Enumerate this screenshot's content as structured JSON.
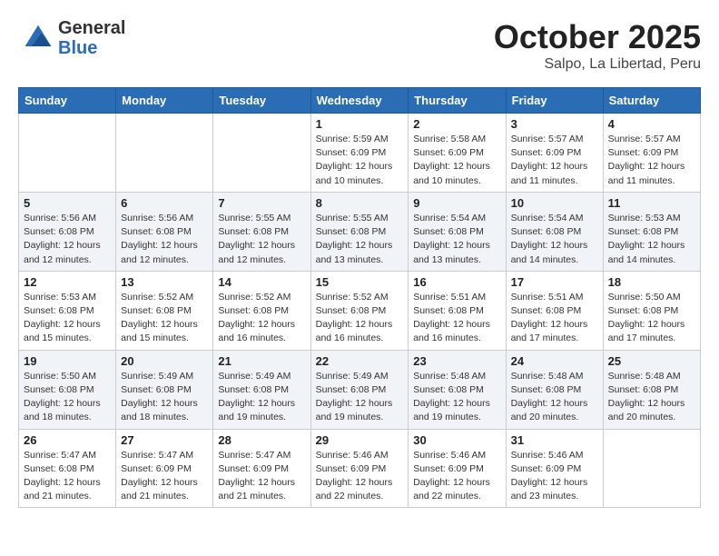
{
  "header": {
    "logo_general": "General",
    "logo_blue": "Blue",
    "month": "October 2025",
    "location": "Salpo, La Libertad, Peru"
  },
  "days_of_week": [
    "Sunday",
    "Monday",
    "Tuesday",
    "Wednesday",
    "Thursday",
    "Friday",
    "Saturday"
  ],
  "weeks": [
    [
      {
        "day": "",
        "info": ""
      },
      {
        "day": "",
        "info": ""
      },
      {
        "day": "",
        "info": ""
      },
      {
        "day": "1",
        "info": "Sunrise: 5:59 AM\nSunset: 6:09 PM\nDaylight: 12 hours\nand 10 minutes."
      },
      {
        "day": "2",
        "info": "Sunrise: 5:58 AM\nSunset: 6:09 PM\nDaylight: 12 hours\nand 10 minutes."
      },
      {
        "day": "3",
        "info": "Sunrise: 5:57 AM\nSunset: 6:09 PM\nDaylight: 12 hours\nand 11 minutes."
      },
      {
        "day": "4",
        "info": "Sunrise: 5:57 AM\nSunset: 6:09 PM\nDaylight: 12 hours\nand 11 minutes."
      }
    ],
    [
      {
        "day": "5",
        "info": "Sunrise: 5:56 AM\nSunset: 6:08 PM\nDaylight: 12 hours\nand 12 minutes."
      },
      {
        "day": "6",
        "info": "Sunrise: 5:56 AM\nSunset: 6:08 PM\nDaylight: 12 hours\nand 12 minutes."
      },
      {
        "day": "7",
        "info": "Sunrise: 5:55 AM\nSunset: 6:08 PM\nDaylight: 12 hours\nand 12 minutes."
      },
      {
        "day": "8",
        "info": "Sunrise: 5:55 AM\nSunset: 6:08 PM\nDaylight: 12 hours\nand 13 minutes."
      },
      {
        "day": "9",
        "info": "Sunrise: 5:54 AM\nSunset: 6:08 PM\nDaylight: 12 hours\nand 13 minutes."
      },
      {
        "day": "10",
        "info": "Sunrise: 5:54 AM\nSunset: 6:08 PM\nDaylight: 12 hours\nand 14 minutes."
      },
      {
        "day": "11",
        "info": "Sunrise: 5:53 AM\nSunset: 6:08 PM\nDaylight: 12 hours\nand 14 minutes."
      }
    ],
    [
      {
        "day": "12",
        "info": "Sunrise: 5:53 AM\nSunset: 6:08 PM\nDaylight: 12 hours\nand 15 minutes."
      },
      {
        "day": "13",
        "info": "Sunrise: 5:52 AM\nSunset: 6:08 PM\nDaylight: 12 hours\nand 15 minutes."
      },
      {
        "day": "14",
        "info": "Sunrise: 5:52 AM\nSunset: 6:08 PM\nDaylight: 12 hours\nand 16 minutes."
      },
      {
        "day": "15",
        "info": "Sunrise: 5:52 AM\nSunset: 6:08 PM\nDaylight: 12 hours\nand 16 minutes."
      },
      {
        "day": "16",
        "info": "Sunrise: 5:51 AM\nSunset: 6:08 PM\nDaylight: 12 hours\nand 16 minutes."
      },
      {
        "day": "17",
        "info": "Sunrise: 5:51 AM\nSunset: 6:08 PM\nDaylight: 12 hours\nand 17 minutes."
      },
      {
        "day": "18",
        "info": "Sunrise: 5:50 AM\nSunset: 6:08 PM\nDaylight: 12 hours\nand 17 minutes."
      }
    ],
    [
      {
        "day": "19",
        "info": "Sunrise: 5:50 AM\nSunset: 6:08 PM\nDaylight: 12 hours\nand 18 minutes."
      },
      {
        "day": "20",
        "info": "Sunrise: 5:49 AM\nSunset: 6:08 PM\nDaylight: 12 hours\nand 18 minutes."
      },
      {
        "day": "21",
        "info": "Sunrise: 5:49 AM\nSunset: 6:08 PM\nDaylight: 12 hours\nand 19 minutes."
      },
      {
        "day": "22",
        "info": "Sunrise: 5:49 AM\nSunset: 6:08 PM\nDaylight: 12 hours\nand 19 minutes."
      },
      {
        "day": "23",
        "info": "Sunrise: 5:48 AM\nSunset: 6:08 PM\nDaylight: 12 hours\nand 19 minutes."
      },
      {
        "day": "24",
        "info": "Sunrise: 5:48 AM\nSunset: 6:08 PM\nDaylight: 12 hours\nand 20 minutes."
      },
      {
        "day": "25",
        "info": "Sunrise: 5:48 AM\nSunset: 6:08 PM\nDaylight: 12 hours\nand 20 minutes."
      }
    ],
    [
      {
        "day": "26",
        "info": "Sunrise: 5:47 AM\nSunset: 6:08 PM\nDaylight: 12 hours\nand 21 minutes."
      },
      {
        "day": "27",
        "info": "Sunrise: 5:47 AM\nSunset: 6:09 PM\nDaylight: 12 hours\nand 21 minutes."
      },
      {
        "day": "28",
        "info": "Sunrise: 5:47 AM\nSunset: 6:09 PM\nDaylight: 12 hours\nand 21 minutes."
      },
      {
        "day": "29",
        "info": "Sunrise: 5:46 AM\nSunset: 6:09 PM\nDaylight: 12 hours\nand 22 minutes."
      },
      {
        "day": "30",
        "info": "Sunrise: 5:46 AM\nSunset: 6:09 PM\nDaylight: 12 hours\nand 22 minutes."
      },
      {
        "day": "31",
        "info": "Sunrise: 5:46 AM\nSunset: 6:09 PM\nDaylight: 12 hours\nand 23 minutes."
      },
      {
        "day": "",
        "info": ""
      }
    ]
  ]
}
